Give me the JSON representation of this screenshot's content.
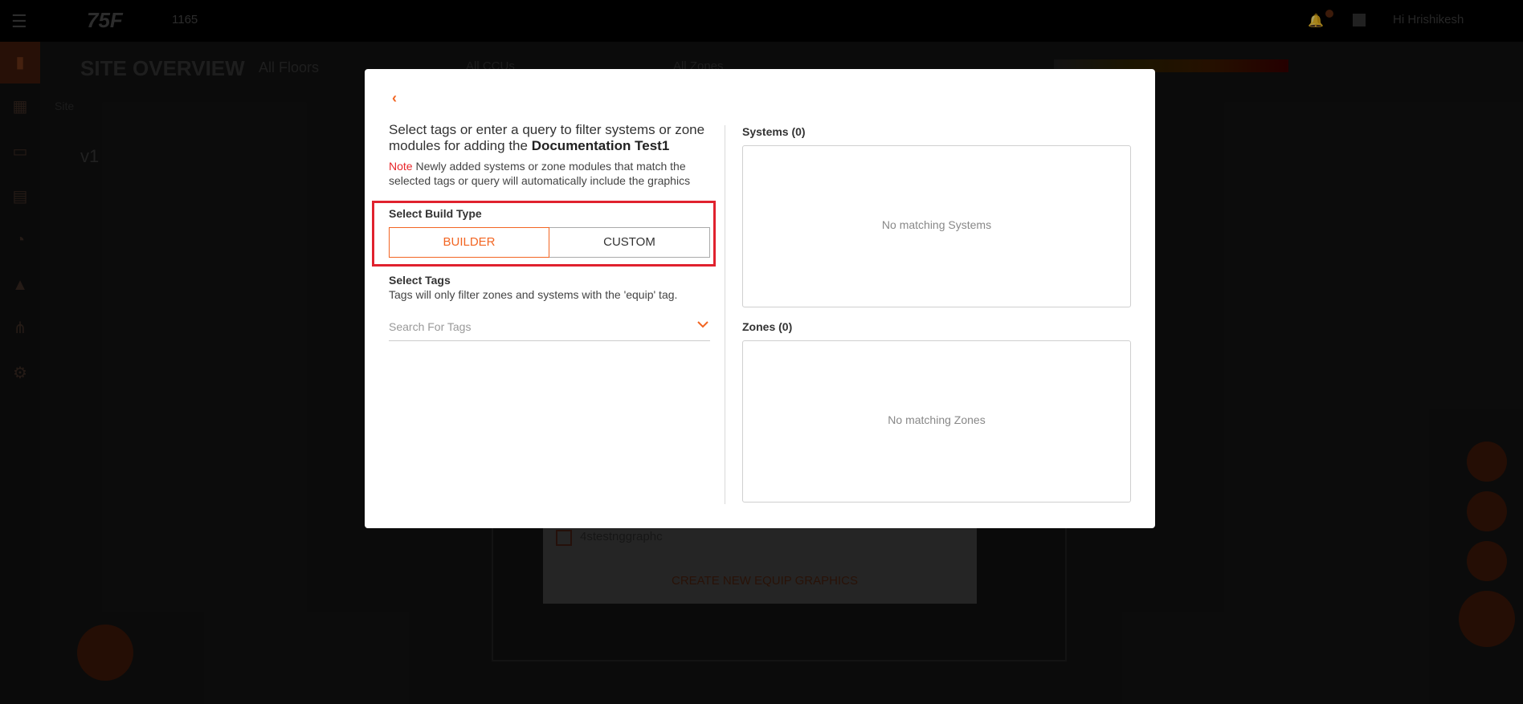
{
  "app": {
    "logo": "75F",
    "site_number": "1165",
    "user_name": "Hi Hrishikesh",
    "page_title": "SITE OVERVIEW",
    "floors_label": "All Floors",
    "filter_1": "All CCUs",
    "filter_2": "All Zones",
    "breadcrumb": "Site",
    "floor_name": "v1",
    "under_list_item": "4stestnggraphc",
    "create_graphics_label": "CREATE NEW EQUIP GRAPHICS"
  },
  "modal": {
    "back_icon": "‹",
    "intro_prefix": "Select tags or enter a query to filter systems or zone modules for adding the",
    "intro_target": "Documentation Test1",
    "note_label": "Note",
    "note_text": "Newly added systems or zone modules that match the selected tags or query will automatically include the graphics",
    "build_type_label": "Select Build Type",
    "build_options": [
      "BUILDER",
      "CUSTOM"
    ],
    "selected_build_option": "BUILDER",
    "tags_label": "Select Tags",
    "tags_help": "Tags will only filter zones and systems with the 'equip' tag.",
    "tags_placeholder": "Search For Tags",
    "systems_label": "Systems (0)",
    "systems_empty": "No matching Systems",
    "zones_label": "Zones (0)",
    "zones_empty": "No matching Zones"
  },
  "colors": {
    "accent": "#f26522",
    "highlight_box": "#e0222e",
    "note_red": "#e8262a"
  }
}
